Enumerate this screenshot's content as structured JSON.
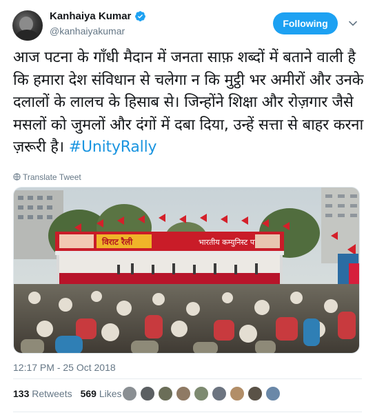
{
  "author": {
    "name": "Kanhaiya Kumar",
    "handle": "@kanhaiyakumar",
    "verified": true,
    "avatar_icon": "profile-photo"
  },
  "follow_button": {
    "label": "Following",
    "color": "#1da1f2"
  },
  "menu_icon": "chevron-down-icon",
  "tweet": {
    "text": "आज पटना के गाँधी मैदान में जनता साफ़ शब्दों में बताने वाली है कि हमारा देश संविधान से चलेगा न कि मुट्ठी भर अमीरों और उनके दलालों के लालच के हिसाब से। जिन्होंने शिक्षा और रोज़गार जैसे मसलों को जुमलों और दंगों में दबा दिया, उन्हें सत्ता से बाहर करना ज़रूरी है।",
    "hashtag": "#UnityRally",
    "hashtag_color": "#1b95e0"
  },
  "translate": {
    "label": "Translate Tweet",
    "icon": "globe-icon"
  },
  "media": {
    "banner_left_text": "विराट रैली",
    "banner_right_text": "भारतीय कम्युनिस्ट पार्टी"
  },
  "timestamp": "12:17 PM - 25 Oct 2018",
  "stats": {
    "retweets_count": "133",
    "retweets_label": "Retweets",
    "likes_count": "569",
    "likes_label": "Likes"
  },
  "likers": [
    {
      "color": "#8a8f93"
    },
    {
      "color": "#5b5f62"
    },
    {
      "color": "#6b6e58"
    },
    {
      "color": "#8f7a64"
    },
    {
      "color": "#7d8a70"
    },
    {
      "color": "#6c7480"
    },
    {
      "color": "#b28e68"
    },
    {
      "color": "#5a5247"
    },
    {
      "color": "#6a88a8"
    }
  ]
}
